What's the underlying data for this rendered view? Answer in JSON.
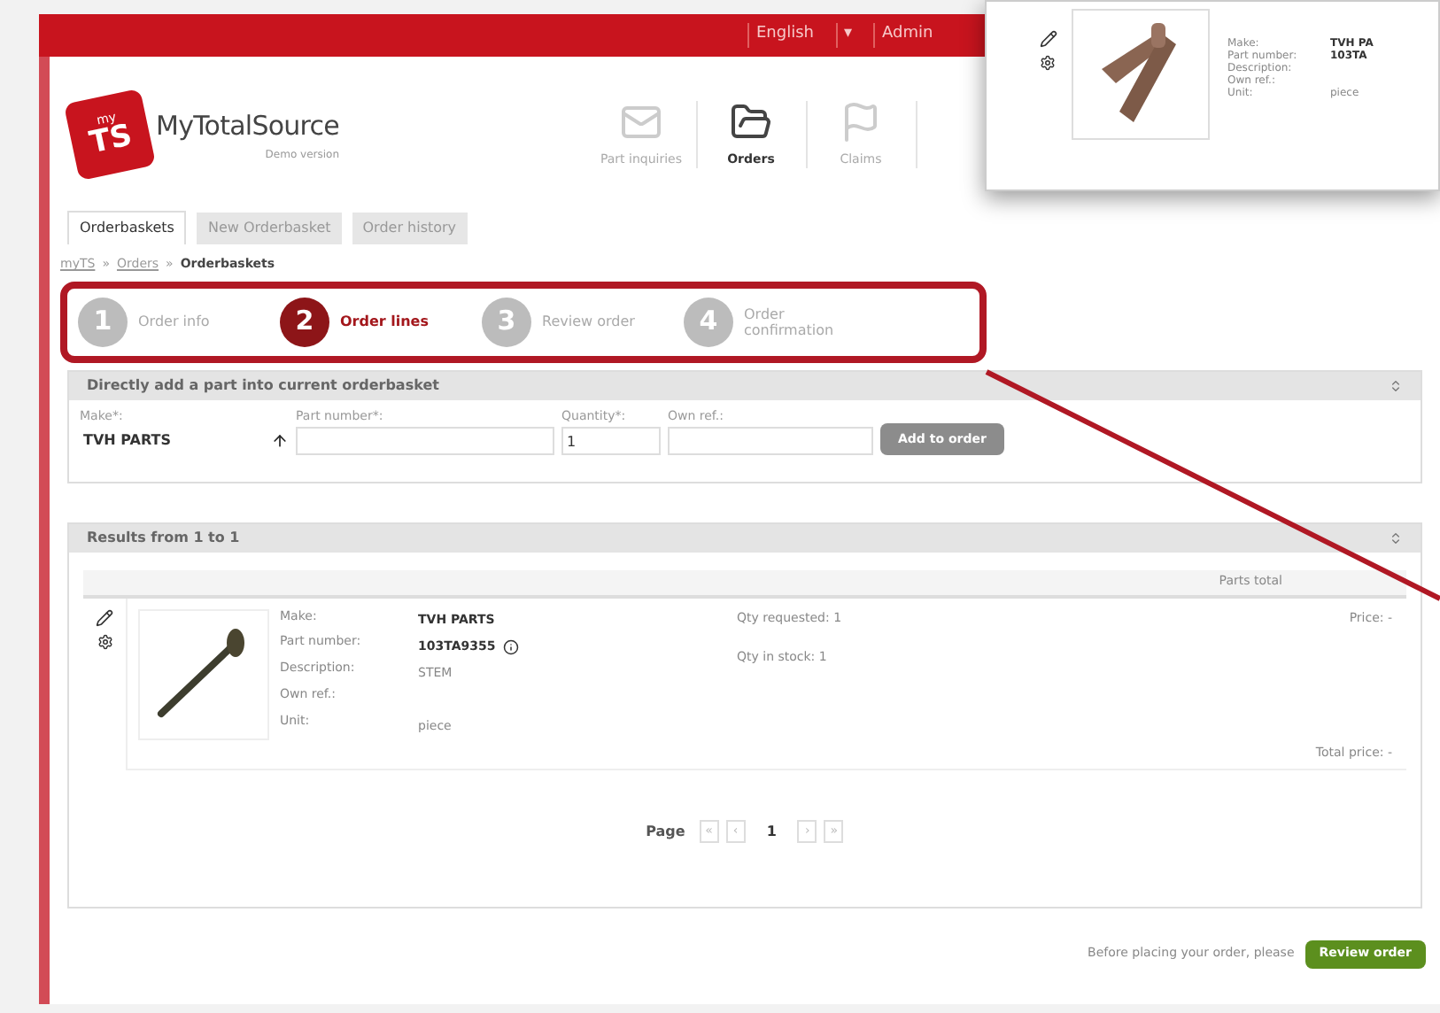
{
  "top_bar": {
    "items": [
      "English",
      "▾",
      "Admin"
    ]
  },
  "logo": {
    "badge_small": "my",
    "badge": "TS",
    "name": "MyTotalSource",
    "subtitle": "Demo version"
  },
  "nav": [
    {
      "label": "Part inquiries",
      "kind": "mail",
      "selected": false
    },
    {
      "label": "Orders",
      "kind": "folder",
      "selected": true
    },
    {
      "label": "Claims",
      "kind": "flag",
      "selected": false
    }
  ],
  "tabs": [
    {
      "label": "Orderbaskets",
      "selected": true
    },
    {
      "label": "New Orderbasket",
      "selected": false
    },
    {
      "label": "Order history",
      "selected": false
    }
  ],
  "breadcrumb_separator": "»",
  "breadcrumb": [
    {
      "label": "myTS",
      "kind": "link"
    },
    {
      "label": "Orders",
      "kind": "link"
    },
    {
      "label": "Orderbaskets",
      "kind": "current"
    }
  ],
  "steps": [
    {
      "number": "1",
      "label": "Order info",
      "selected": false
    },
    {
      "number": "2",
      "label": "Order lines",
      "selected": true
    },
    {
      "number": "3",
      "label": "Review order",
      "selected": false
    },
    {
      "number": "4",
      "label": "Order confirmation",
      "selected": false
    }
  ],
  "add_part": {
    "title": "Directly add a part into current orderbasket",
    "fields": [
      {
        "label": "Make*:",
        "value": "TVH PARTS",
        "kind": "select"
      },
      {
        "label": "Part number*:",
        "kind": "text"
      },
      {
        "label": "Quantity*:",
        "value": "1",
        "kind": "text"
      },
      {
        "label": "Own ref.:",
        "kind": "text"
      }
    ],
    "button": "Add to order"
  },
  "results": {
    "title": "Results from 1 to 1",
    "column": "Parts total",
    "item": {
      "details": [
        {
          "label": "Make:",
          "value": "TVH PARTS"
        },
        {
          "label": "Part number:",
          "value": "103TA9355"
        },
        {
          "label": "Description:",
          "value": "STEM"
        },
        {
          "label": "Own ref.:"
        },
        {
          "label": "Unit:",
          "value": "piece"
        }
      ],
      "qty_requested": "Qty requested: 1",
      "qty_in_stock": "Qty in stock: 1",
      "price": "Price: -",
      "total_price": "Total price: -"
    },
    "pagination": {
      "label": "Page",
      "prev": [
        "«",
        "‹"
      ],
      "current": "1",
      "next": [
        "›",
        "»"
      ]
    }
  },
  "footer": {
    "text": "Before placing your order, please",
    "button": "Review order"
  },
  "popup": {
    "details": [
      {
        "label": "Make:",
        "value": "TVH PA"
      },
      {
        "label": "Part number:",
        "value": "103TA"
      },
      {
        "label": "Description:"
      },
      {
        "label": "Own ref.:"
      },
      {
        "label": "Unit:",
        "value": "piece"
      }
    ]
  }
}
